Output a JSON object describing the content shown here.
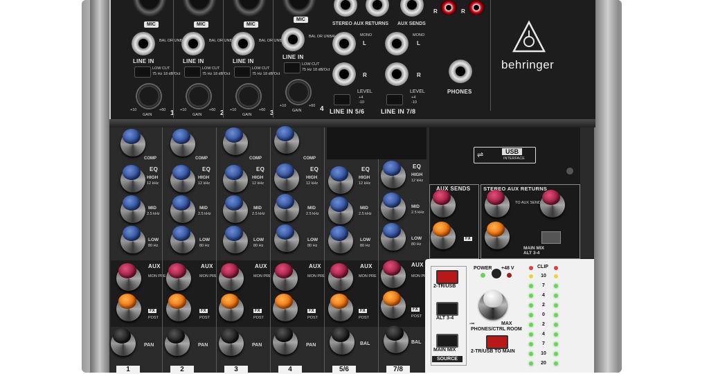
{
  "brand": "behringer",
  "top": {
    "mic_label": "MIC",
    "line_in_label": "LINE IN",
    "bal_unbal": "BAL OR UNBAL",
    "low_cut": "LOW CUT",
    "low_cut_sub": "75 Hz 18 dB/Oct",
    "gain_label": "GAIN",
    "gain_range_min": "+10",
    "gain_range_max": "+60",
    "channel_numbers": [
      "1",
      "2",
      "3",
      "4"
    ],
    "stereo_aux_returns": "STEREO AUX RETURNS",
    "aux_sends": "AUX SENDS",
    "mono": "MONO",
    "l": "L",
    "r": "R",
    "level": "LEVEL",
    "level_plus": "+4",
    "level_minus": "-10",
    "line_in_56": "LINE IN 5/6",
    "line_in_78": "LINE IN 7/8",
    "phones": "PHONES"
  },
  "strips": {
    "comp": "COMP",
    "eq": "EQ",
    "high": "HIGH",
    "high_freq": "12 kHz",
    "mid": "MID",
    "mid_freq": "2.5 kHz",
    "low": "LOW",
    "low_freq": "80 Hz",
    "aux": "AUX",
    "mon_pre": "MON PRE",
    "fx_tag": "FX",
    "post": "POST",
    "pan": "PAN",
    "bal": "BAL",
    "channel_labels": [
      "1",
      "2",
      "3",
      "4",
      "5/6",
      "7/8"
    ]
  },
  "usb": {
    "usb": "USB",
    "interface": "INTERFACE"
  },
  "aux_panel": {
    "aux_sends": "AUX SENDS",
    "stereo_aux_returns": "STEREO AUX RETURNS",
    "to_aux": "TO AUX SEND 1",
    "main_mix": "MAIN MIX",
    "alt_34": "ALT 3-4",
    "fx": "FX"
  },
  "source": {
    "two_tr_usb": "2-TR/USB",
    "alt_34": "ALT 3-4",
    "main_mix": "MAIN MIX",
    "source_label": "SOURCE",
    "power": "POWER",
    "plus48": "+48 V",
    "phones_ctrl": "PHONES/CTRL ROOM",
    "max": "MAX",
    "min": "-∞",
    "two_tr_to_main": "2-TR/USB TO MAIN",
    "clip": "CLIP",
    "meter_scale": [
      "10",
      "7",
      "4",
      "2",
      "0",
      "2",
      "4",
      "7",
      "10",
      "20"
    ]
  }
}
